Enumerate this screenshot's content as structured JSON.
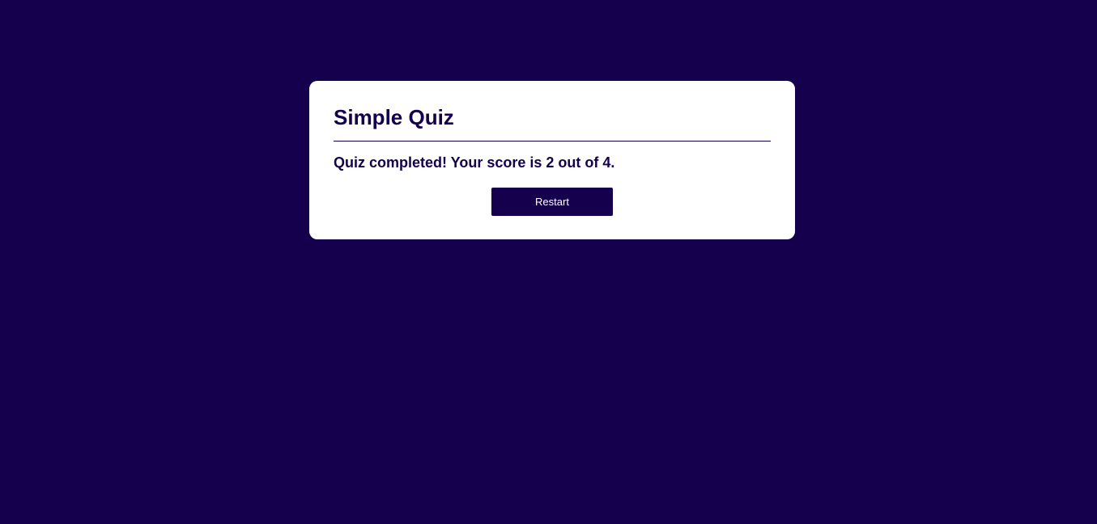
{
  "quiz": {
    "title": "Simple Quiz",
    "result_message": "Quiz completed! Your score is 2 out of 4.",
    "score": 2,
    "total": 4,
    "restart_label": "Restart"
  },
  "colors": {
    "background": "#14004d",
    "card": "#ffffff",
    "accent": "#14004d",
    "button_text": "#ffffff"
  }
}
